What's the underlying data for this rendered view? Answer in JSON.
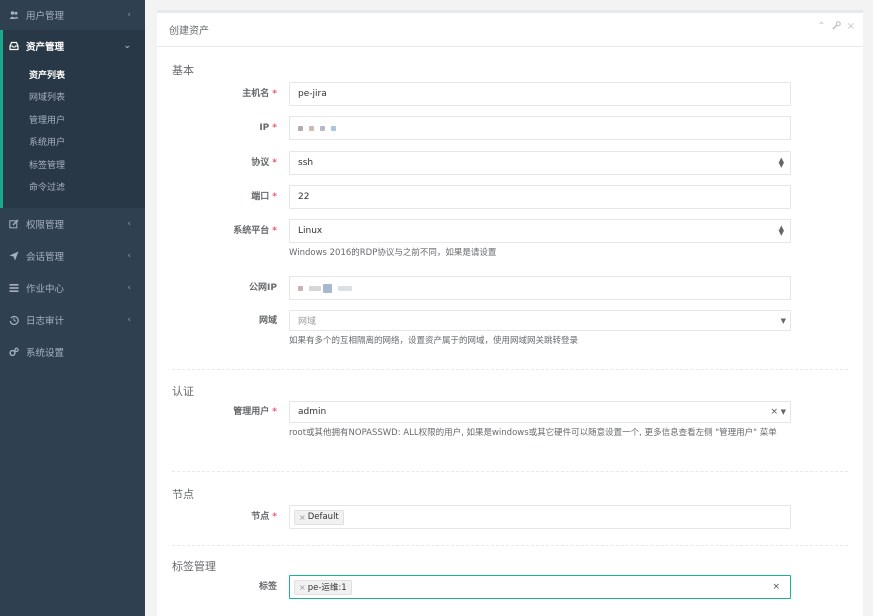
{
  "sidebar": {
    "items": [
      {
        "label": "用户管理",
        "icon": "users-icon"
      },
      {
        "label": "资产管理",
        "icon": "inbox-icon"
      },
      {
        "label": "权限管理",
        "icon": "edit-icon"
      },
      {
        "label": "会话管理",
        "icon": "send-icon"
      },
      {
        "label": "作业中心",
        "icon": "list-icon"
      },
      {
        "label": "日志审计",
        "icon": "history-icon"
      },
      {
        "label": "系统设置",
        "icon": "gears-icon"
      }
    ],
    "sub_items": [
      "资产列表",
      "网域列表",
      "管理用户",
      "系统用户",
      "标签管理",
      "命令过滤"
    ]
  },
  "panel": {
    "title": "创建资产"
  },
  "sections": {
    "basic": "基本",
    "auth": "认证",
    "node": "节点",
    "tags": "标签管理"
  },
  "form": {
    "hostname": {
      "label": "主机名",
      "value": "pe-jira"
    },
    "ip": {
      "label": "IP"
    },
    "protocol": {
      "label": "协议",
      "value": "ssh"
    },
    "port": {
      "label": "端口",
      "value": "22"
    },
    "platform": {
      "label": "系统平台",
      "value": "Linux",
      "help": "Windows 2016的RDP协议与之前不同，如果是请设置"
    },
    "public_ip": {
      "label": "公网IP"
    },
    "domain": {
      "label": "网域",
      "placeholder": "网域",
      "help": "如果有多个的互相隔离的网络，设置资产属于的网域，使用网域网关跳转登录"
    },
    "admin_user": {
      "label": "管理用户",
      "value": "admin",
      "help": "root或其他拥有NOPASSWD: ALL权限的用户, 如果是windows或其它硬件可以随意设置一个, 更多信息查看左侧 \"管理用户\" 菜单"
    },
    "nodes": {
      "label": "节点",
      "tag": "Default"
    },
    "labels": {
      "label": "标签",
      "tag": "pe-运维:1"
    }
  },
  "icons": {
    "remove": "×",
    "required": "*"
  },
  "colors": {
    "sidebar_bg": "#2f4050",
    "accent": "#1ab394",
    "required": "#ed5565"
  }
}
